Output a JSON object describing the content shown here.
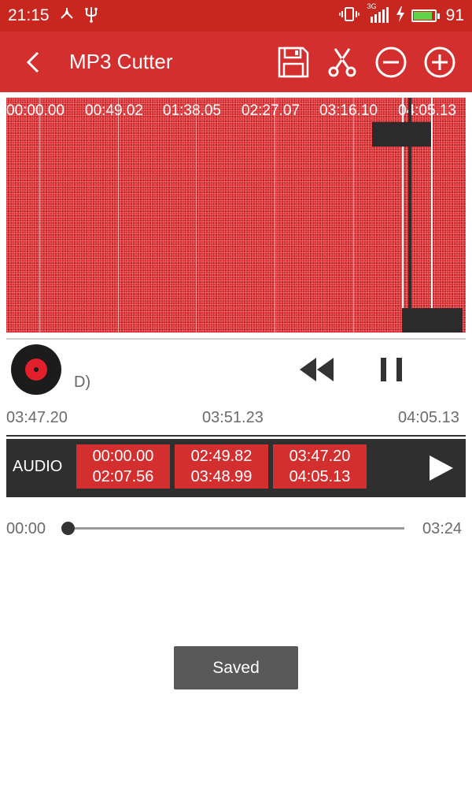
{
  "status_bar": {
    "time": "21:15",
    "network": "3G",
    "battery_level": "91",
    "battery_fraction": 0.91,
    "icons": [
      "share-nodes-icon",
      "usb-icon",
      "vibrate-icon",
      "signal-icon",
      "charging-icon",
      "battery-icon"
    ]
  },
  "toolbar": {
    "title": "MP3 Cutter",
    "icons": [
      "back-arrow-icon",
      "save-icon",
      "scissors-icon",
      "zoom-out-icon",
      "zoom-in-icon"
    ]
  },
  "waveform": {
    "timestamps": [
      "00:00.00",
      "00:49.02",
      "01:38.05",
      "02:27.07",
      "03:16.10",
      "04:05.13"
    ]
  },
  "track": {
    "title": "",
    "subtitle_prefix": "D",
    "subtitle_blurred": "",
    "subtitle_suffix": ")",
    "icons": [
      "vinyl-disc-icon",
      "rewind-icon",
      "pause-icon"
    ]
  },
  "ruler": {
    "start": "03:47.20",
    "mid": "03:51.23",
    "end": "04:05.13"
  },
  "audio_bar": {
    "label": "AUDIO",
    "segments": [
      {
        "start": "00:00.00",
        "end": "02:07.56"
      },
      {
        "start": "02:49.82",
        "end": "03:48.99"
      },
      {
        "start": "03:47.20",
        "end": "04:05.13"
      }
    ],
    "play_icon": "play-icon"
  },
  "seek": {
    "current": "00:00",
    "total": "03:24",
    "progress": 0
  },
  "toast": {
    "message": "Saved"
  },
  "colors": {
    "primary": "#d32f2f",
    "status_bar": "#c8271f",
    "dark": "#2f2f2f"
  }
}
